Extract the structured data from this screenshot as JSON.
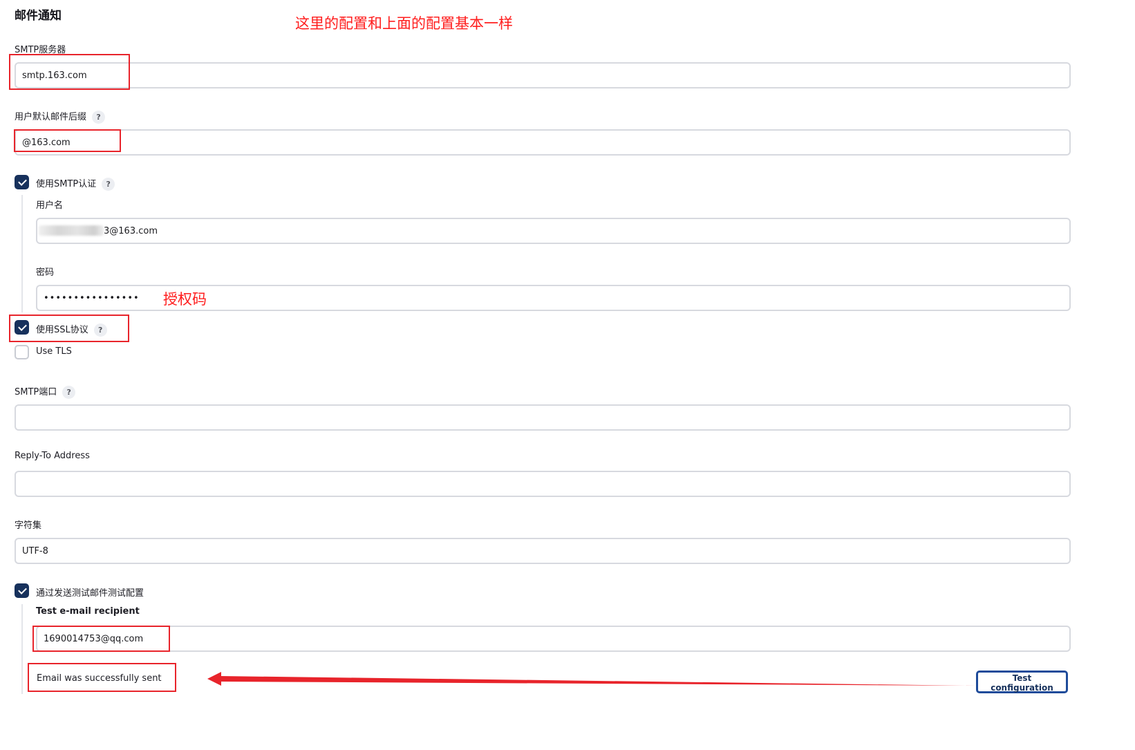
{
  "section": {
    "title": "邮件通知"
  },
  "annotations": {
    "top_note": "这里的配置和上面的配置基本一样",
    "password_note": "授权码"
  },
  "smtp_server": {
    "label": "SMTP服务器",
    "value": "smtp.163.com"
  },
  "default_suffix": {
    "label": "用户默认邮件后缀",
    "value": "@163.com"
  },
  "smtp_auth": {
    "label": "使用SMTP认证",
    "checked": true,
    "username": {
      "label": "用户名",
      "value": "3@163.com"
    },
    "password": {
      "label": "密码",
      "value": "••••••••••••••••"
    }
  },
  "use_ssl": {
    "label": "使用SSL协议",
    "checked": true
  },
  "use_tls": {
    "label": "Use TLS",
    "checked": false
  },
  "smtp_port": {
    "label": "SMTP端口",
    "value": ""
  },
  "reply_to": {
    "label": "Reply-To Address",
    "value": ""
  },
  "charset": {
    "label": "字符集",
    "value": "UTF-8"
  },
  "test_mail": {
    "label": "通过发送测试邮件测试配置",
    "checked": true,
    "recipient_label": "Test e-mail recipient",
    "recipient_value": "1690014753@qq.com",
    "status": "Email was successfully sent",
    "button_label": "Test configuration"
  },
  "help_glyph": "?",
  "colors": {
    "annotation_red": "#e8242b",
    "checkbox_navy": "#17315c",
    "button_border": "#1e4b9a"
  }
}
